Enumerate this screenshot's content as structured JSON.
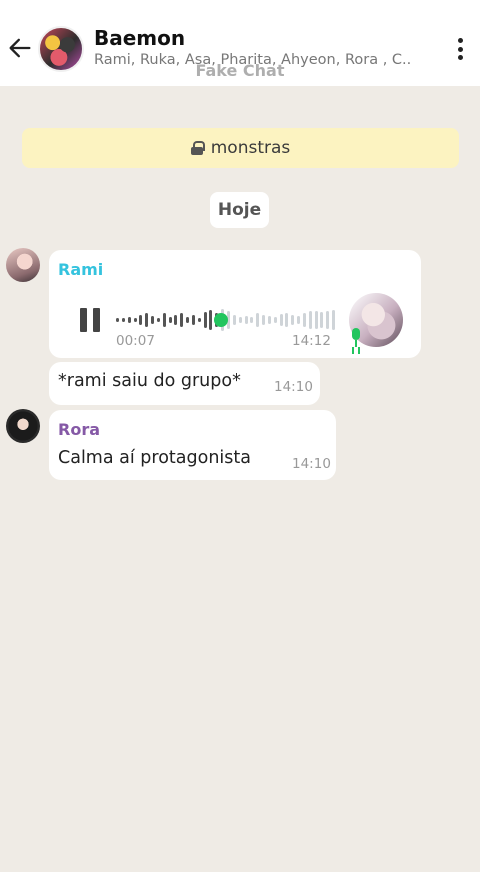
{
  "header": {
    "group_name": "Baemon",
    "members": "Rami, Ruka, Asa, Pharita, Ahyeon, Rora , C..",
    "watermark": "Fake Chat"
  },
  "banner": {
    "text": "monstras"
  },
  "date_divider": "Hoje",
  "messages": [
    {
      "sender": "Rami",
      "sender_color": "#35c3de",
      "type": "voice",
      "duration": "00:07",
      "time": "14:12",
      "progress": 0.47
    },
    {
      "type": "text",
      "text": "*rami saiu do grupo*",
      "time": "14:10"
    },
    {
      "sender": "Rora",
      "sender_color": "#8559a6",
      "type": "text",
      "text": "Calma aí protagonista",
      "time": "14:10"
    }
  ],
  "colors": {
    "background": "#efebe5",
    "banner": "#fcf3c1",
    "accent_green": "#22c55e"
  }
}
